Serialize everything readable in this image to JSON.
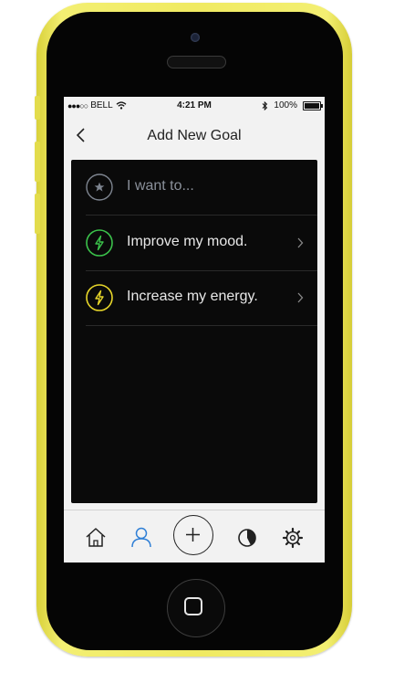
{
  "status_bar": {
    "signal": "●●●○○",
    "carrier": "BELL",
    "time": "4:21 PM",
    "battery_percent": "100%",
    "battery_level": 1.0
  },
  "nav": {
    "title": "Add New Goal",
    "back_icon": "chevron-left-icon"
  },
  "goals": {
    "prompt": {
      "label": "I want to...",
      "icon": "star-icon",
      "color": "#7e8590"
    },
    "items": [
      {
        "label": "Improve my mood.",
        "icon": "lightning-icon",
        "color": "#3bc24b"
      },
      {
        "label": "Increase my energy.",
        "icon": "lightning-icon",
        "color": "#e8d72a"
      }
    ]
  },
  "tab_bar": {
    "items": [
      "home-icon",
      "user-icon",
      "add-icon",
      "pie-chart-icon",
      "gear-icon"
    ],
    "active": "user-icon",
    "active_color": "#2f7fd6"
  },
  "colors": {
    "phone_body": "#f0ea62",
    "content_background": "#0a0a0a",
    "text_light": "#e8e8e8"
  }
}
